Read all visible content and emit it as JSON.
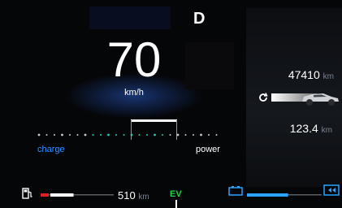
{
  "gear": "D",
  "speed": {
    "value": "70",
    "unit": "km/h"
  },
  "odometer": {
    "value": "47410",
    "unit": "km"
  },
  "trip": {
    "value": "123.4",
    "unit": "km"
  },
  "power_meter": {
    "left_label": "charge",
    "right_label": "power"
  },
  "fuel": {
    "range_value": "510",
    "range_unit": "km",
    "level": 0.45
  },
  "drive_mode": "EV",
  "battery": {
    "level": 0.55
  },
  "colors": {
    "charge": "#2f8fff",
    "ev": "#1fd64a",
    "fuel_low": "#e02020",
    "battery": "#2aa3ff"
  },
  "icons": [
    "fuel-pump-icon",
    "battery-icon",
    "regen-icon",
    "reset-icon",
    "car-icon"
  ]
}
